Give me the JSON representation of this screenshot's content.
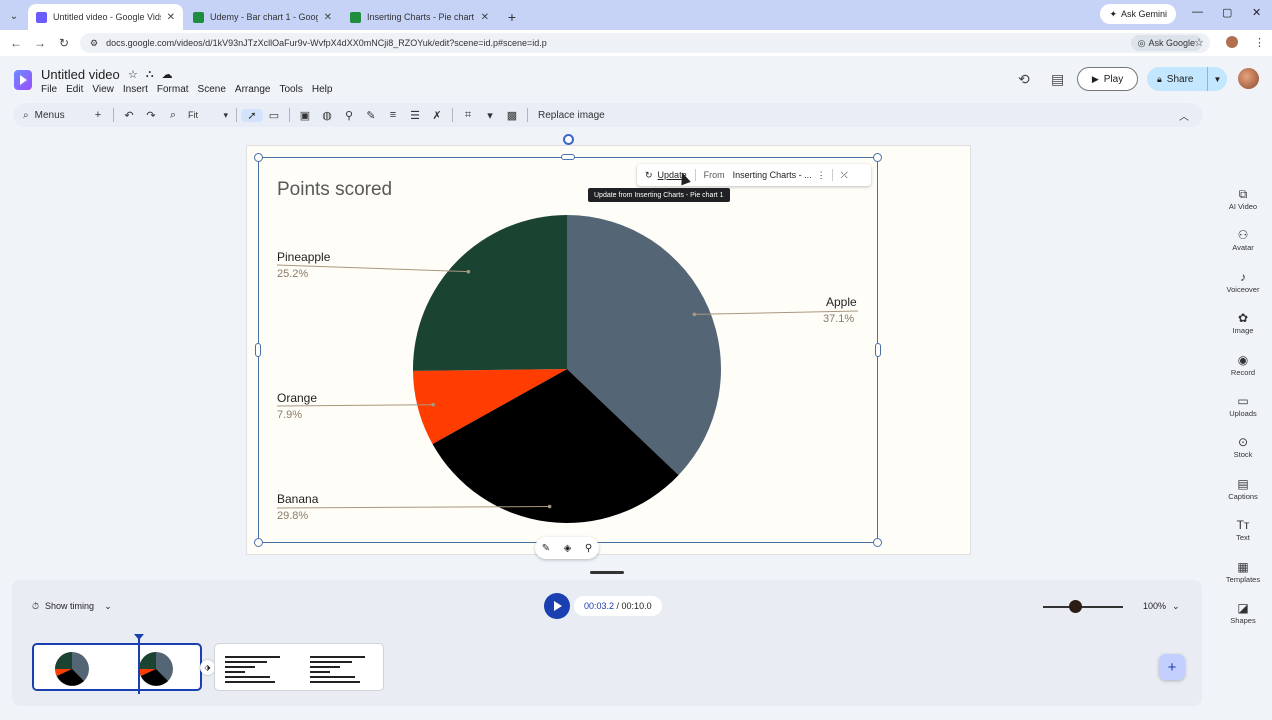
{
  "browser": {
    "tabs": [
      {
        "title": "Untitled video - Google Vids",
        "active": true,
        "favicon_color": "#6b5cff"
      },
      {
        "title": "Udemy - Bar chart 1 - Google S",
        "active": false,
        "favicon_color": "#1e8e3e"
      },
      {
        "title": "Inserting Charts - Pie chart 1 - G",
        "active": false,
        "favicon_color": "#1e8e3e"
      }
    ],
    "new_tab": "+",
    "ask_gemini": "Ask Gemini",
    "url": "docs.google.com/videos/d/1kV93nJTzXcllOaFur9v-WvfpX4dXX0mNCji8_RZOYuk/edit?scene=id.p#scene=id.p",
    "ask_google": "Ask Google"
  },
  "app": {
    "title": "Untitled video",
    "menu": [
      "File",
      "Edit",
      "View",
      "Insert",
      "Format",
      "Scene",
      "Arrange",
      "Tools",
      "Help"
    ],
    "play_label": "Play",
    "share_label": "Share"
  },
  "toolbar": {
    "menus_label": "Menus",
    "zoom_value": "Fit",
    "replace_image_label": "Replace image"
  },
  "linked_chart_chip": {
    "update_label": "Update",
    "from_label": "From",
    "source_label": "Inserting Charts - ...",
    "tooltip": "Update from Inserting Charts - Pie chart 1"
  },
  "chart_data": {
    "type": "pie",
    "title": "Points scored",
    "slices": [
      {
        "label": "Apple",
        "value": 37.1,
        "display": "37.1%",
        "color": "#546675"
      },
      {
        "label": "Banana",
        "value": 29.8,
        "display": "29.8%",
        "color": "#000000"
      },
      {
        "label": "Orange",
        "value": 7.9,
        "display": "7.9%",
        "color": "#ff3d00"
      },
      {
        "label": "Pineapple",
        "value": 25.2,
        "display": "25.2%",
        "color": "#1b4332"
      }
    ],
    "start_angle_deg": 0,
    "direction": "clockwise",
    "legend": "labeled slices"
  },
  "right_sidebar": [
    {
      "label": "AI Video",
      "icon": "ai-video-icon"
    },
    {
      "label": "Avatar",
      "icon": "avatar-icon"
    },
    {
      "label": "Voiceover",
      "icon": "voiceover-icon"
    },
    {
      "label": "Image",
      "icon": "image-icon"
    },
    {
      "label": "Record",
      "icon": "record-icon"
    },
    {
      "label": "Uploads",
      "icon": "uploads-icon"
    },
    {
      "label": "Stock",
      "icon": "stock-icon"
    },
    {
      "label": "Captions",
      "icon": "captions-icon"
    },
    {
      "label": "Text",
      "icon": "text-icon"
    },
    {
      "label": "Templates",
      "icon": "templates-icon"
    },
    {
      "label": "Shapes",
      "icon": "shapes-icon"
    }
  ],
  "timeline": {
    "show_timing_label": "Show timing",
    "current_time": "00:03.2",
    "separator": " / ",
    "total_time": "00:10.0",
    "zoom_percent": "100%",
    "zoom_level": 0.4
  },
  "colors": {
    "accent": "#1a3fb0",
    "selection": "#4a6fa5",
    "share_bg": "#c2e7ff"
  }
}
